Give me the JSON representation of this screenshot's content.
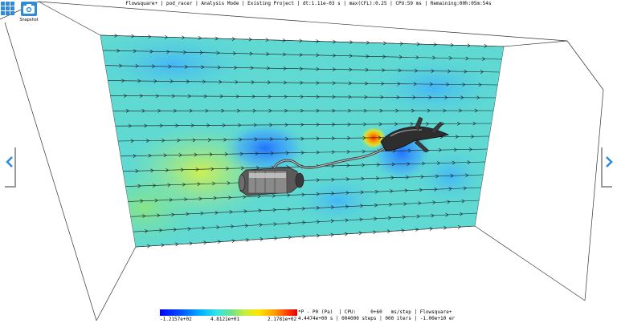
{
  "status": {
    "text": "Flowsquare+ | pod_racer | Analysis Mode | Existing Project | dt:1.11e-03 s | max(CFL):0.25 | CPU:59 ms | Remaining:00h:05m:54s"
  },
  "toolbar": {
    "menu_icon": "grid-menu-icon",
    "snapshot_icon": "camera-icon",
    "snapshot_label": "Snapshot"
  },
  "navigation": {
    "left_icon": "chevron-left-icon",
    "right_icon": "chevron-right-icon"
  },
  "colorbar": {
    "min_label": "-1.2157e+02",
    "mid_label": "4.8121e+01",
    "max_label": "2.1781e+02"
  },
  "info": {
    "line1": "*P - P0 (Pa)  | CPU:     0+60   ms/step | Flowsquare+",
    "line2": "4.4474e+00 s | 004000 steps | 000 iters | -1.00e+10 er"
  },
  "colors": {
    "accent": "#2f8ad8",
    "field_base": "#5fd9d2"
  }
}
